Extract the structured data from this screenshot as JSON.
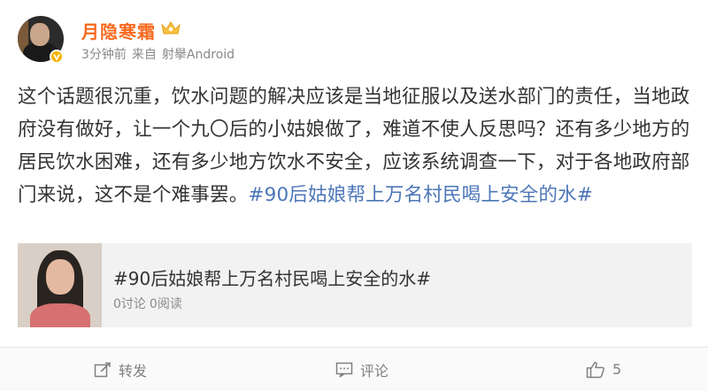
{
  "post": {
    "author": {
      "name": "月隐寒霜",
      "avatar_icon": "avatar-photo",
      "verified_icon": "verified-v-icon",
      "member_icon": "crown-icon"
    },
    "meta": {
      "time": "3分钟前",
      "source_prefix": "来自",
      "source": "射擧Android"
    },
    "content": {
      "text": "这个话题很沉重，饮水问题的解决应该是当地征服以及送水部门的责任，当地政府没有做好，让一个九〇后的小姑娘做了，难道不使人反思吗？还有多少地方的居民饮水困难，还有多少地方饮水不安全，应该系统调查一下，对于各地政府部门来说，这不是个难事罢。",
      "hashtag": "#90后姑娘帮上万名村民喝上安全的水#"
    },
    "topic_card": {
      "title": "#90后姑娘帮上万名村民喝上安全的水#",
      "discussions": "0讨论",
      "reads": "0阅读"
    },
    "actions": {
      "repost_label": "转发",
      "comment_label": "评论",
      "like_count": "5"
    }
  },
  "colors": {
    "username": "#f7691f",
    "hashtag": "#4c76b8",
    "meta": "#8a8a8a",
    "body_text": "#333333",
    "card_bg": "#f2f2f2"
  }
}
